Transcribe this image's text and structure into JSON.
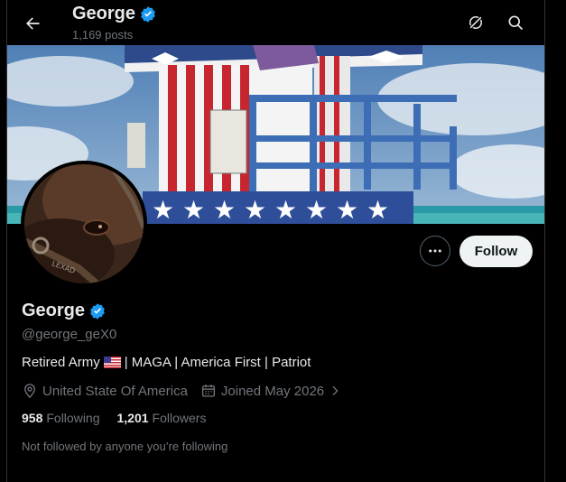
{
  "header": {
    "name": "George",
    "posts": "1,169 posts"
  },
  "profile": {
    "name": "George",
    "handle": "@george_geX0",
    "bio_before_flag": "Retired Army",
    "bio_after_flag": "| MAGA | America First | Patriot",
    "location": "United State Of America",
    "joined": "Joined May 2026",
    "following_count": "958",
    "following_label": "Following",
    "followers_count": "1,201",
    "followers_label": "Followers",
    "not_followed": "Not followed by anyone you’re following"
  },
  "actions": {
    "follow_label": "Follow"
  },
  "colors": {
    "verified": "#1d9bf0",
    "background": "#000000",
    "follow_bg": "#eff3f4"
  }
}
